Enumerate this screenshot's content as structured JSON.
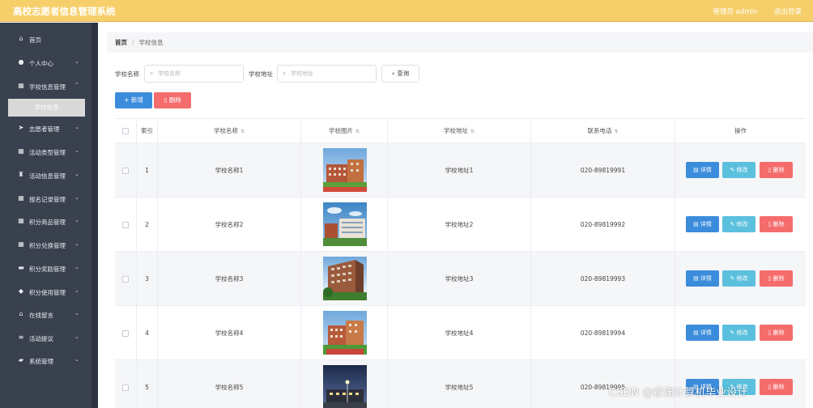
{
  "app": {
    "title": "高校志愿者信息管理系统"
  },
  "header": {
    "user_label": "管理员 admin",
    "logout_label": "退出登录"
  },
  "sidebar": {
    "items": [
      {
        "label": "首页",
        "icon": "home-icon",
        "has_children": false
      },
      {
        "label": "个人中心",
        "icon": "user-icon",
        "has_children": true
      },
      {
        "label": "学校信息管理",
        "icon": "grid-icon",
        "has_children": true
      },
      {
        "label": "志愿者管理",
        "icon": "send-icon",
        "has_children": true
      },
      {
        "label": "活动类型管理",
        "icon": "grid-icon",
        "has_children": true
      },
      {
        "label": "活动信息管理",
        "icon": "trophy-icon",
        "has_children": true
      },
      {
        "label": "报名记录管理",
        "icon": "grid-icon",
        "has_children": true
      },
      {
        "label": "积分商品管理",
        "icon": "grid-icon",
        "has_children": true
      },
      {
        "label": "积分兑换管理",
        "icon": "grid-icon",
        "has_children": true
      },
      {
        "label": "积分奖励管理",
        "icon": "ticket-icon",
        "has_children": true
      },
      {
        "label": "积分使用管理",
        "icon": "pin-icon",
        "has_children": true
      },
      {
        "label": "在线留言",
        "icon": "home-icon",
        "has_children": true
      },
      {
        "label": "活动提议",
        "icon": "sliders-icon",
        "has_children": true
      },
      {
        "label": "系统管理",
        "icon": "chat-icon",
        "has_children": true
      }
    ],
    "active_submenu": "学校信息"
  },
  "breadcrumb": {
    "home": "首页",
    "separator": "/",
    "current": "学校信息"
  },
  "search": {
    "name_label": "学校名称",
    "name_placeholder": "学校名称",
    "address_label": "学校地址",
    "address_placeholder": "学校地址",
    "query_label": "查询"
  },
  "actions": {
    "add_label": "新增",
    "delete_label": "删除"
  },
  "table": {
    "columns": [
      "索引",
      "学校名称",
      "学校图片",
      "学校地址",
      "联系电话",
      "操作"
    ],
    "rows": [
      {
        "index": "1",
        "name": "学校名称1",
        "address": "学校地址1",
        "phone": "020-89819991"
      },
      {
        "index": "2",
        "name": "学校名称2",
        "address": "学校地址2",
        "phone": "020-89819992"
      },
      {
        "index": "3",
        "name": "学校名称3",
        "address": "学校地址3",
        "phone": "020-89819993"
      },
      {
        "index": "4",
        "name": "学校名称4",
        "address": "学校地址4",
        "phone": "020-89819994"
      },
      {
        "index": "5",
        "name": "学校名称5",
        "address": "学校地址5",
        "phone": "020-89819995"
      }
    ],
    "row_actions": {
      "detail": "详情",
      "edit": "修改",
      "delete": "删除"
    }
  },
  "watermark": "CSDN @睿渊计算机毕业设计",
  "colors": {
    "topbar": "#f7cf6a",
    "sidebar": "#39404e",
    "primary": "#3b8ddc",
    "info": "#5bc0de",
    "danger": "#f56c6c"
  }
}
